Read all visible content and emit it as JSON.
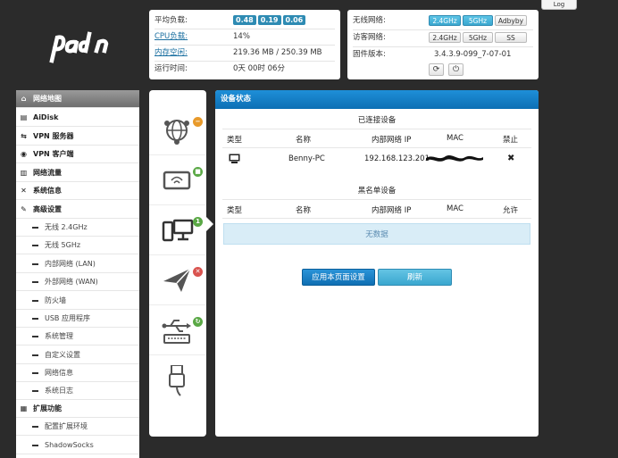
{
  "header": {
    "logout_label": "Log"
  },
  "status": {
    "load_label": "平均负载:",
    "load_values": [
      "0.48",
      "0.19",
      "0.06"
    ],
    "cpu_label": "CPU负载:",
    "cpu_value": "14%",
    "mem_label": "内存空闲:",
    "mem_value": "219.36 MB / 250.39 MB",
    "uptime_label": "运行时间:",
    "uptime_value": "0天 00时 06分"
  },
  "wireless": {
    "wifi_label": "无线网络:",
    "wifi_buttons": [
      "2.4GHz",
      "5GHz",
      "Adbyby"
    ],
    "guest_label": "访客网络:",
    "guest_buttons": [
      "2.4GHz",
      "5GHz",
      "SS"
    ],
    "fw_label": "固件版本:",
    "fw_value": "3.4.3.9-099_7-07-01"
  },
  "sidebar": {
    "items": [
      {
        "label": "网络地图",
        "icon": "⌂"
      },
      {
        "label": "AiDisk",
        "icon": "▤"
      },
      {
        "label": "VPN 服务器",
        "icon": "⇆"
      },
      {
        "label": "VPN 客户端",
        "icon": "◉"
      },
      {
        "label": "网络流量",
        "icon": "▥"
      },
      {
        "label": "系统信息",
        "icon": "✕"
      },
      {
        "label": "高级设置",
        "icon": "✎"
      },
      {
        "label": "无线 2.4GHz"
      },
      {
        "label": "无线 5GHz"
      },
      {
        "label": "内部网络 (LAN)"
      },
      {
        "label": "外部网络 (WAN)"
      },
      {
        "label": "防火墙"
      },
      {
        "label": "USB 应用程序"
      },
      {
        "label": "系统管理"
      },
      {
        "label": "自定义设置"
      },
      {
        "label": "网络信息"
      },
      {
        "label": "系统日志"
      },
      {
        "label": "扩展功能",
        "icon": "▦"
      },
      {
        "label": "配置扩展环境"
      },
      {
        "label": "ShadowSocks"
      }
    ]
  },
  "panel": {
    "title": "设备状态",
    "connected_title": "已连接设备",
    "connected_headers": [
      "类型",
      "名称",
      "内部网络 IP",
      "MAC",
      "禁止"
    ],
    "device": {
      "name": "Benny-PC",
      "ip": "192.168.123.201",
      "block": "✖"
    },
    "blacklist_title": "黑名单设备",
    "blacklist_headers": [
      "类型",
      "名称",
      "内部网络 IP",
      "MAC",
      "允许"
    ],
    "no_data": "无数据",
    "apply_label": "应用本页面设置",
    "refresh_label": "刷新"
  },
  "colors": {
    "accent": "#0d6fb4",
    "active_button": "#3aa7cf",
    "background": "#2b2b2b"
  }
}
